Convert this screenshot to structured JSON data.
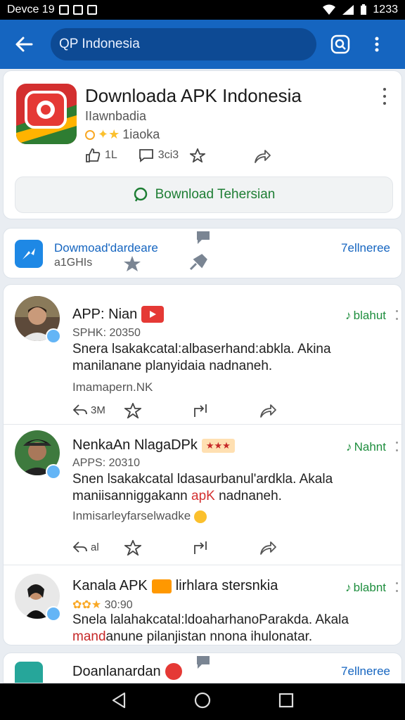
{
  "status_bar": {
    "device": "Devce 19",
    "time": "1233"
  },
  "search": {
    "value": "QP Indonesia"
  },
  "app_card": {
    "title": "Downloada APK Indonesia",
    "subtitle": "IIawnbadia",
    "rating_text": "1iaoka",
    "like_count": "1L",
    "comment_count": "3ci3",
    "download_button": "Bownload Tehersian"
  },
  "promo_card": {
    "title": "Dowmoad'dardeare",
    "subtitle": "a1GHIs",
    "right_link": "7ellneree"
  },
  "posts": [
    {
      "name": "APP: Nian",
      "meta": "SPHK: 20350",
      "body": "Snera lsakakcatal:albaserhand:abkla. Akina manilanane planyidaia nadnaneh.",
      "footer": "Imamapern.NK",
      "follow": "blahut",
      "reply_count": "3M"
    },
    {
      "name": "NenkaAn NlagaDPk",
      "name_badge": "★★★",
      "meta": "APPS: 20310",
      "body_line1": "Snen lsakakcatal ldasaurbanul'ardkla. Akala",
      "body_line2a": "maniisanniggakann ",
      "body_line2b": "apK",
      "body_line2c": " nadnaneh.",
      "footer": "Inmisarleyfarselwadke",
      "follow": "Nahnt",
      "reply_count": "al"
    },
    {
      "name": "Kanala APK",
      "name_extra": "lirhlara stersnkia",
      "meta": "30:90",
      "body_line1": "Snela lalahakcatal:ldoaharhanoParakda. Akala",
      "body_line2a": "mand",
      "body_line2b": "anune pilanjistan nnona ihulonatar.",
      "follow": "blabnt"
    }
  ],
  "bottom_card": {
    "title": "Doanlanardan",
    "right_link": "7ellneree"
  },
  "colors": {
    "appbar": "#1565c0",
    "accent_green": "#1e8e3e",
    "link_blue": "#1565c0"
  }
}
